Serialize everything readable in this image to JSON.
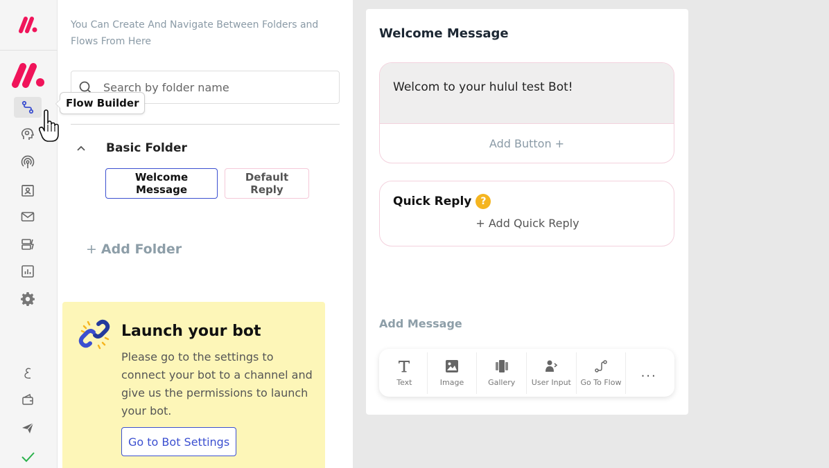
{
  "tooltip": {
    "label": "Flow Builder"
  },
  "rail": {
    "items": [
      {
        "icon": "flow-builder-icon",
        "active": true
      },
      {
        "icon": "ai-settings-icon"
      },
      {
        "icon": "broadcast-icon"
      },
      {
        "icon": "contacts-icon"
      },
      {
        "icon": "mail-icon"
      },
      {
        "icon": "automation-icon"
      },
      {
        "icon": "analytics-icon"
      },
      {
        "icon": "gear-icon"
      },
      {
        "icon": "language-icon"
      },
      {
        "icon": "wallet-icon"
      },
      {
        "icon": "send-icon"
      },
      {
        "icon": "checkmark-icon"
      }
    ]
  },
  "folders": {
    "intro": "You Can Create And Navigate Between Folders and Flows From Here",
    "search_placeholder": "Search by folder name",
    "folder_name": "Basic Folder",
    "flows": [
      "Welcome Message",
      "Default Reply"
    ],
    "add_folder": "Add Folder"
  },
  "launch": {
    "title": "Launch your bot",
    "body": "Please go to the settings to connect your bot to a channel and give us the permissions to launch your bot.",
    "button": "Go to Bot Settings"
  },
  "editor": {
    "title": "Welcome Message",
    "message_text": "Welcom to your hulul test Bot!",
    "add_button": "Add Button +",
    "quick_reply_title": "Quick Reply",
    "quick_reply_help": "?",
    "add_quick_reply": "+ Add Quick Reply",
    "add_message_label": "Add Message",
    "tools": [
      "Text",
      "Image",
      "Gallery",
      "User Input",
      "Go To Flow"
    ],
    "more": "..."
  },
  "colors": {
    "brand": "#f0145a",
    "accent": "#3b4fd0",
    "launch_bg": "#fdf6b8",
    "warning": "#f5b520"
  }
}
